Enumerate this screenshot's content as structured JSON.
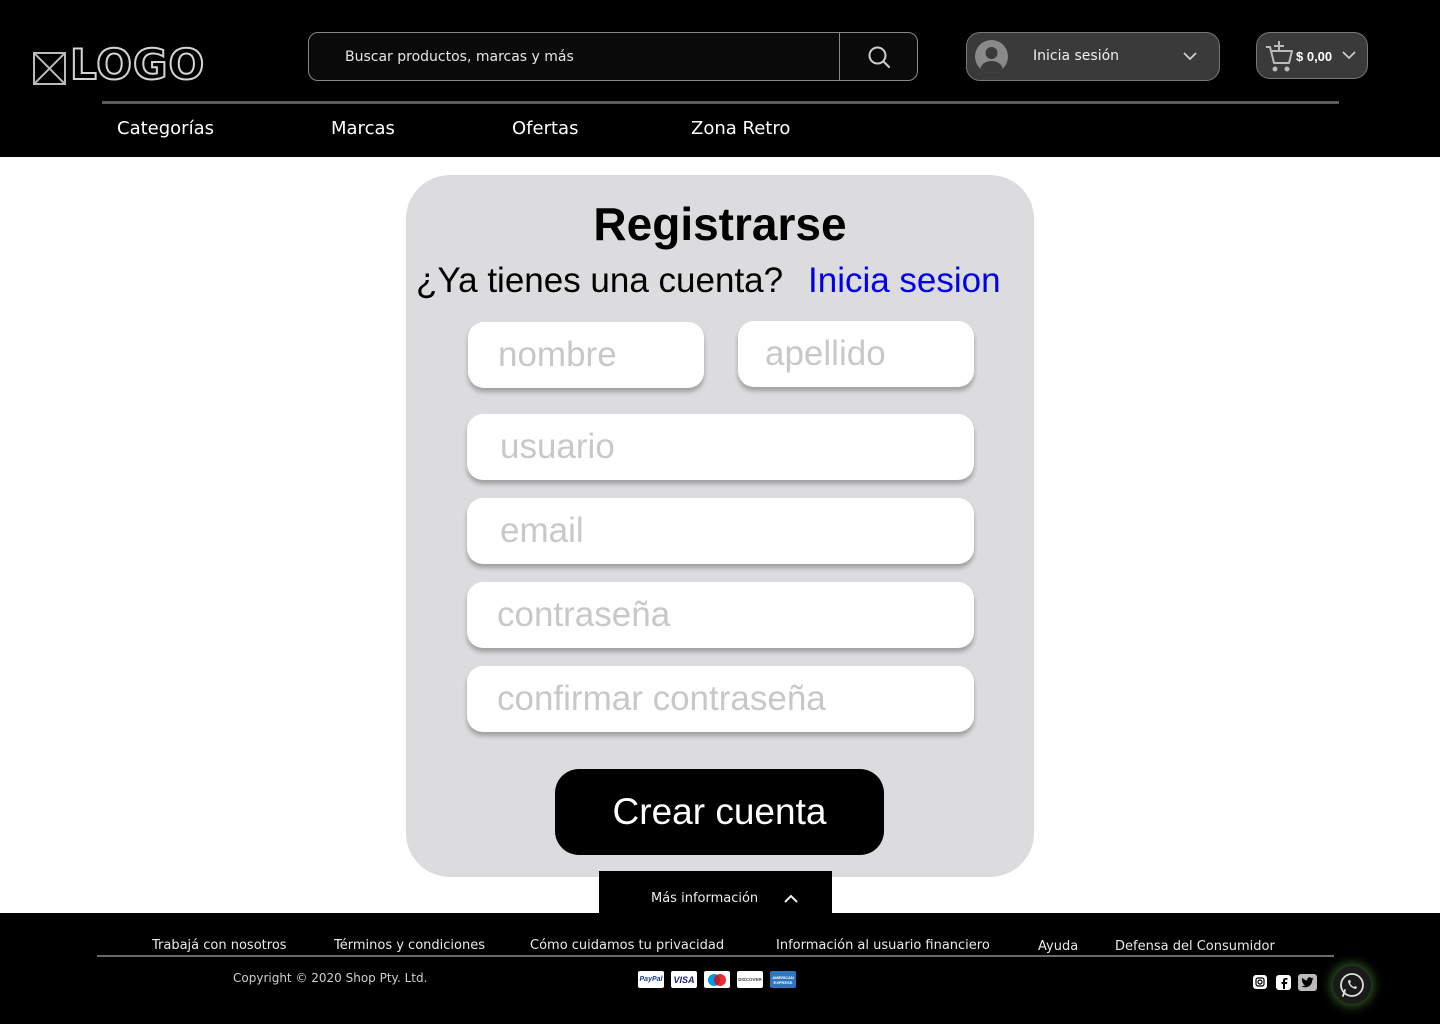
{
  "header": {
    "logo_text": "LOGO",
    "search": {
      "placeholder": "Buscar productos, marcas y más"
    },
    "account": {
      "label": "Inicia sesión"
    },
    "cart": {
      "amount": "$ 0,00"
    },
    "nav": [
      "Categorías",
      "Marcas",
      "Ofertas",
      "Zona Retro"
    ]
  },
  "register": {
    "title": "Registrarse",
    "prompt": "¿Ya tienes una cuenta?",
    "login_link": "Inicia sesion",
    "fields": {
      "first_name": "nombre",
      "last_name": "apellido",
      "username": "usuario",
      "email": "email",
      "password": "contraseña",
      "confirm_password": "confirmar contraseña"
    },
    "submit_label": "Crear cuenta"
  },
  "footer": {
    "more_info": "Más información",
    "links": [
      "Trabajá con nosotros",
      "Términos y condiciones",
      "Cómo cuidamos tu privacidad",
      "Información al usuario financiero",
      "Ayuda",
      "Defensa del Consumidor"
    ],
    "copyright": "Copyright © 2020 Shop Pty. Ltd.",
    "payment_methods": [
      "PayPal",
      "VISA",
      "maestro",
      "DISCOVER",
      "AMERICAN EXPRESS"
    ],
    "social_icons": [
      "instagram-icon",
      "facebook-icon",
      "twitter-icon",
      "whatsapp-icon"
    ]
  },
  "colors": {
    "header_bg": "#000000",
    "card_bg": "#dcdcde",
    "link_blue": "#0000e6",
    "placeholder_gray": "#c8c8c8"
  }
}
